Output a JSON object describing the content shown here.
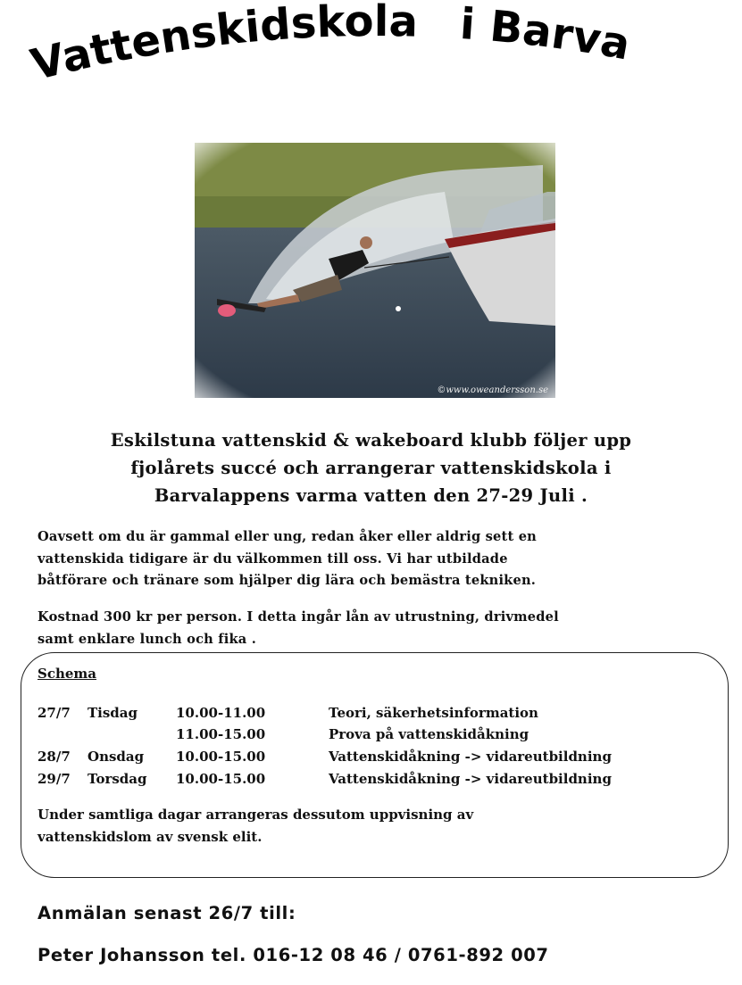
{
  "title": {
    "part1": "Vattenskidskola",
    "part2": "i Barva"
  },
  "photo": {
    "watermark": "©www.oweandersson.se"
  },
  "intro": {
    "line1": "Eskilstuna vattenskid & wakeboard klubb följer upp",
    "line2": "fjolårets succé och arrangerar vattenskidskola i",
    "line3": "Barvalappens varma vatten den 27-29 Juli ."
  },
  "paragraph1": {
    "line1": "Oavsett om du är gammal eller ung, redan åker eller aldrig sett en",
    "line2": "vattenskida tidigare är du välkommen till oss.  Vi har utbildade",
    "line3": "båtförare och tränare som hjälper dig lära och bemästra tekniken."
  },
  "paragraph2": {
    "line1": "Kostnad 300 kr per person. I detta ingår lån av utrustning,  drivmedel",
    "line2": "samt enklare lunch och fika ."
  },
  "schedule": {
    "heading": "Schema",
    "rows": [
      {
        "date": "27/7",
        "day": "Tisdag",
        "time": "10.00-11.00",
        "activity": "Teori, säkerhetsinformation"
      },
      {
        "date": "",
        "day": "",
        "time": "11.00-15.00",
        "activity": "Prova på vattenskidåkning"
      },
      {
        "date": "28/7",
        "day": "Onsdag",
        "time": "10.00-15.00",
        "activity": "Vattenskidåkning -> vidareutbildning"
      },
      {
        "date": "29/7",
        "day": "Torsdag",
        "time": "10.00-15.00",
        "activity": "Vattenskidåkning -> vidareutbildning"
      }
    ],
    "note_line1": "Under samtliga dagar arrangeras dessutom uppvisning av",
    "note_line2": "vattenskidslom av svensk elit."
  },
  "registration": {
    "deadline": "Anmälan senast 26/7 till:",
    "contact": "Peter Johansson tel. 016-12 08 46 / 0761-892 007"
  }
}
